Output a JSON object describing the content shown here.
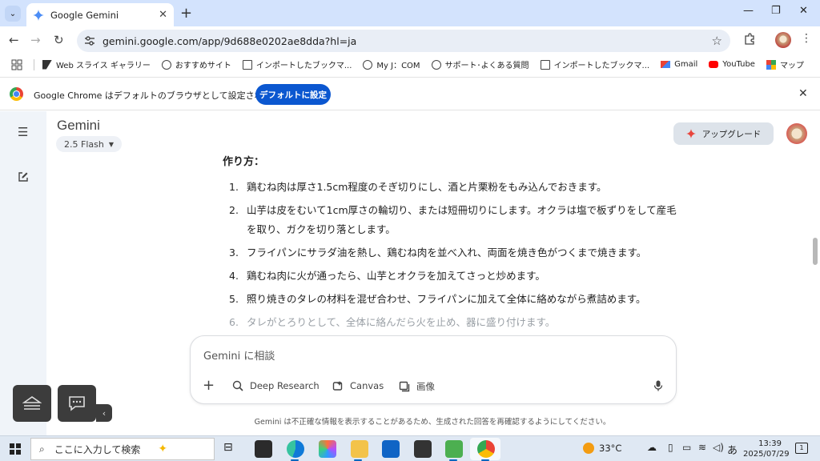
{
  "browser": {
    "tab_title": "Google Gemini",
    "url": "gemini.google.com/app/9d688e0202ae8dda?hl=ja",
    "bookmarks": [
      {
        "label": "Web スライス ギャラリー",
        "icon": "web-slice-icon"
      },
      {
        "label": "おすすめサイト",
        "icon": "globe-icon"
      },
      {
        "label": "インポートしたブックマ...",
        "icon": "folder-icon"
      },
      {
        "label": "My J：COM",
        "icon": "globe-icon"
      },
      {
        "label": "サポート･よくある質問",
        "icon": "globe-icon"
      },
      {
        "label": "インポートしたブックマ...",
        "icon": "folder-icon"
      },
      {
        "label": "Gmail",
        "icon": "gmail-icon"
      },
      {
        "label": "YouTube",
        "icon": "youtube-icon"
      },
      {
        "label": "マップ",
        "icon": "maps-icon"
      }
    ],
    "infobar": {
      "message": "Google Chrome はデフォルトのブラウザとして設定されていません",
      "button": "デフォルトに設定"
    }
  },
  "gemini": {
    "title": "Gemini",
    "model": "2.5 Flash",
    "upgrade_label": "アップグレード",
    "section_title": "作り方：",
    "steps": [
      {
        "num": "1.",
        "text": "鶏むね肉は厚さ1.5cm程度のそぎ切りにし、酒と片栗粉をもみ込んでおきます。"
      },
      {
        "num": "2.",
        "text": "山芋は皮をむいて1cm厚さの輪切り、または短冊切りにします。オクラは塩で板ずりをして産毛を取り、ガクを切り落とします。"
      },
      {
        "num": "3.",
        "text": "フライパンにサラダ油を熱し、鶏むね肉を並べ入れ、両面を焼き色がつくまで焼きます。"
      },
      {
        "num": "4.",
        "text": "鶏むね肉に火が通ったら、山芋とオクラを加えてさっと炒めます。"
      },
      {
        "num": "5.",
        "text": "照り焼きのタレの材料を混ぜ合わせ、フライパンに加えて全体に絡めながら煮詰めます。"
      },
      {
        "num": "6.",
        "text": "タレがとろりとして、全体に絡んだら火を止め、器に盛り付けます。"
      }
    ],
    "composer": {
      "placeholder": "Gemini に相談",
      "tools": [
        "Deep Research",
        "Canvas",
        "画像"
      ]
    },
    "disclaimer": "Gemini は不正確な情報を表示することがあるため、生成された回答を再確認するようにしてください。"
  },
  "taskbar": {
    "search_placeholder": "ここに入力して検索",
    "weather": "33°C",
    "ime": "あ",
    "time": "13:39",
    "date": "2025/07/29",
    "notification_count": "1"
  }
}
